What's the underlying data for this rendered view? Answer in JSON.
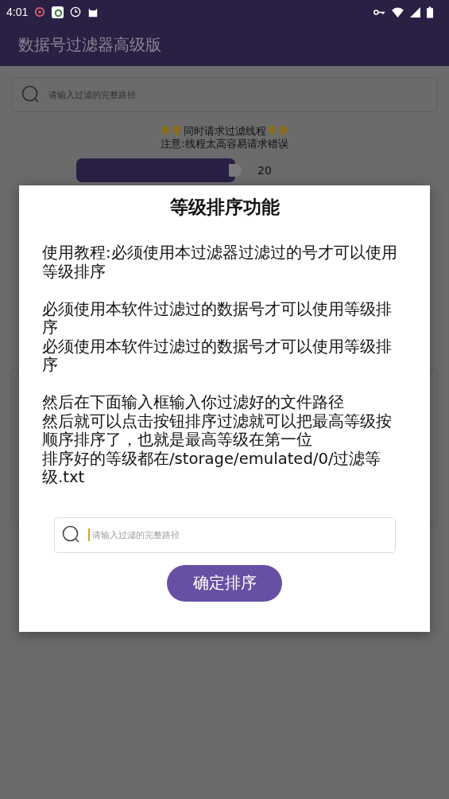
{
  "status_bar": {
    "time": "4:01"
  },
  "app_bar": {
    "title": "数据号过滤器高级版"
  },
  "search": {
    "placeholder": "请输入过滤的完整路径"
  },
  "threads": {
    "label": "同时请求过滤线程",
    "warning": "注意:线程太高容易请求错误",
    "slider": {
      "level": 1,
      "value": "20"
    }
  },
  "dialog": {
    "title": "等级排序功能",
    "paragraphs": [
      [
        "使用教程:必须使用本过滤器过滤过的号才可以使用等级排序"
      ],
      [
        "必须使用本软件过滤过的数据号才可以使用等级排序",
        "必须使用本软件过滤过的数据号才可以使用等级排序"
      ],
      [
        "然后在下面输入框输入你过滤好的文件路径",
        "然后就可以点击按钮排序过滤就可以把最高等级按顺序排序了，也就是最高等级在第一位",
        "排序好的等级都在/storage/emulated/0/过滤等级.txt"
      ]
    ],
    "input": {
      "placeholder": "请输入过滤的完整路径",
      "focused": true
    },
    "button": "确定排序"
  }
}
